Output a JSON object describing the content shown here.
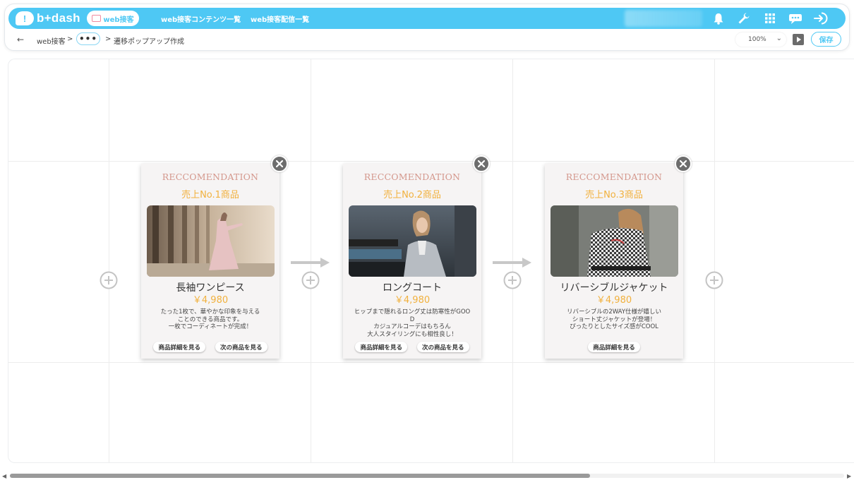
{
  "app": {
    "logo_text": "b+dash",
    "logo_mark": "!"
  },
  "nav": {
    "active_tab": "web接客",
    "links": [
      "web接客コンテンツ一覧",
      "web接客配信一覧"
    ],
    "icons": [
      "bell-icon",
      "wrench-icon",
      "grid-icon",
      "chat-icon",
      "logout-icon"
    ]
  },
  "breadcrumb": {
    "back": "←",
    "items": [
      "web接客",
      "•••",
      "遷移ポップアップ作成"
    ],
    "sep": ">"
  },
  "toolbar": {
    "zoom": "100%",
    "zoom_chevron": "⌄",
    "save_label": "保存"
  },
  "cards": [
    {
      "heading": "RECCOMENDATION",
      "rank": "売上No.1商品",
      "name": "長袖ワンピース",
      "price": "￥4,980",
      "desc": "たった1枚で、華やかな印象を与える\nことのできる商品です。\n一枚でコーディネートが完成！",
      "buttons": [
        "商品詳細を見る",
        "次の商品を見る"
      ]
    },
    {
      "heading": "RECCOMENDATION",
      "rank": "売上No.2商品",
      "name": "ロングコート",
      "price": "￥4,980",
      "desc": "ヒップまで隠れるロング丈は防寒性がGOO\nD\nカジュアルコーデはもちろん\n大人スタイリングにも相性良し！",
      "buttons": [
        "商品詳細を見る",
        "次の商品を見る"
      ]
    },
    {
      "heading": "RECCOMENDATION",
      "rank": "売上No.3商品",
      "name": "リバーシブルジャケット",
      "price": "￥4,980",
      "desc": "リバーシブルの2WAY仕様が嬉しい\nショート丈ジャケットが登場！\nぴったりとしたサイズ感がCOOL",
      "buttons": [
        "商品詳細を見る"
      ]
    }
  ],
  "colors": {
    "brand": "#4ec8f4",
    "heading": "#d4978c",
    "accent": "#f1b13e",
    "close": "#6d6d6d"
  }
}
